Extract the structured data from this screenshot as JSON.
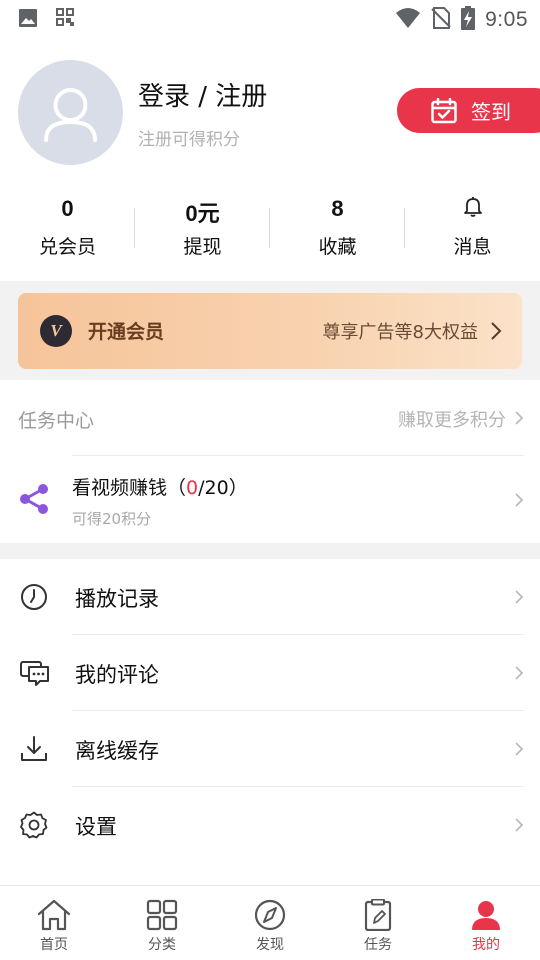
{
  "status_bar": {
    "time": "9:05",
    "icons": [
      "image-icon",
      "qr-grid-icon",
      "wifi-icon",
      "no-sim-icon",
      "battery-charging-icon"
    ]
  },
  "profile": {
    "login_title": "登录 / 注册",
    "login_subtitle": "注册可得积分",
    "signin_label": "签到",
    "avatar_icon": "user-silhouette-icon",
    "accent_color": "#e8354a"
  },
  "stats": [
    {
      "value": "0",
      "label": "兑会员"
    },
    {
      "value": "0元",
      "label": "提现"
    },
    {
      "value": "8",
      "label": "收藏"
    },
    {
      "icon": "bell-icon",
      "label": "消息"
    }
  ],
  "vip": {
    "badge": "V",
    "title": "开通会员",
    "description": "尊享广告等8大权益"
  },
  "task_center": {
    "title": "任务中心",
    "more": "赚取更多积分",
    "tasks": [
      {
        "name_prefix": "看视频赚钱（",
        "progress_done": "0",
        "progress_rest": "/20）",
        "reward": "可得20积分",
        "icon": "share-icon"
      }
    ]
  },
  "menu": [
    {
      "label": "播放记录",
      "icon": "clock-icon"
    },
    {
      "label": "我的评论",
      "icon": "comment-icon"
    },
    {
      "label": "离线缓存",
      "icon": "download-icon"
    },
    {
      "label": "设置",
      "icon": "gear-icon"
    }
  ],
  "bottom_nav": [
    {
      "label": "首页",
      "icon": "home-icon"
    },
    {
      "label": "分类",
      "icon": "category-grid-icon"
    },
    {
      "label": "发现",
      "icon": "compass-icon"
    },
    {
      "label": "任务",
      "icon": "clipboard-icon"
    },
    {
      "label": "我的",
      "icon": "person-icon",
      "active": true
    }
  ]
}
